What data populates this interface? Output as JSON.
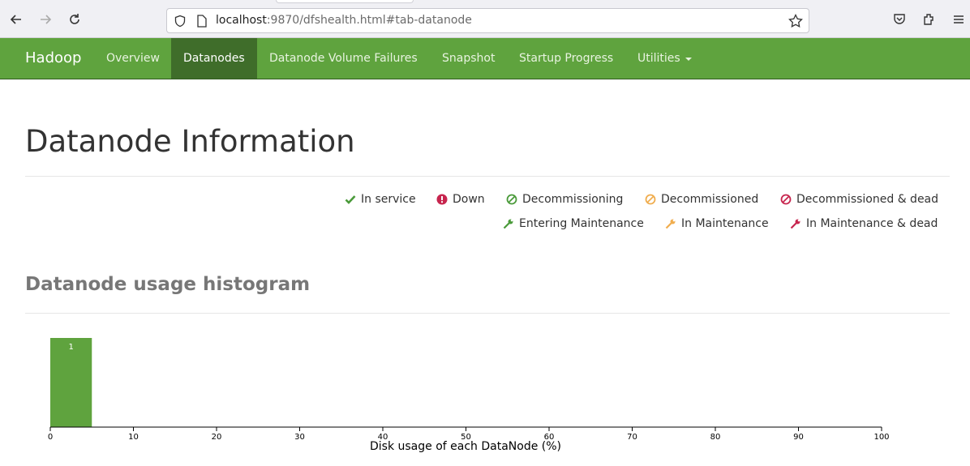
{
  "browser": {
    "url_host": "localhost",
    "url_rest": ":9870/dfshealth.html#tab-datanode"
  },
  "navbar": {
    "brand": "Hadoop",
    "items": [
      {
        "label": "Overview"
      },
      {
        "label": "Datanodes"
      },
      {
        "label": "Datanode Volume Failures"
      },
      {
        "label": "Snapshot"
      },
      {
        "label": "Startup Progress"
      },
      {
        "label": "Utilities"
      }
    ],
    "active_color": "#3f6d2a",
    "bar_color": "#5fa33e"
  },
  "page": {
    "title": "Datanode Information",
    "legend": [
      {
        "label": "In service",
        "icon": "check-icon",
        "color": "#4a9a3a"
      },
      {
        "label": "Down",
        "icon": "exclamation-circle-icon",
        "color": "#c7254e"
      },
      {
        "label": "Decommissioning",
        "icon": "ban-icon",
        "color": "#4a9a3a"
      },
      {
        "label": "Decommissioned",
        "icon": "ban-icon",
        "color": "#f0ad4e"
      },
      {
        "label": "Decommissioned & dead",
        "icon": "ban-icon",
        "color": "#c7254e"
      },
      {
        "label": "Entering Maintenance",
        "icon": "wrench-icon",
        "color": "#4a9a3a"
      },
      {
        "label": "In Maintenance",
        "icon": "wrench-icon",
        "color": "#f0ad4e"
      },
      {
        "label": "In Maintenance & dead",
        "icon": "wrench-icon",
        "color": "#c7254e"
      }
    ],
    "histogram_title": "Datanode usage histogram"
  },
  "chart_data": {
    "type": "bar",
    "title": "",
    "xlabel": "Disk usage of each DataNode (%)",
    "ylabel": "",
    "xlim": [
      0,
      100
    ],
    "x_ticks": [
      0,
      10,
      20,
      30,
      40,
      50,
      60,
      70,
      80,
      90,
      100
    ],
    "bins": [
      {
        "x0": 0,
        "x1": 5,
        "count": 1
      }
    ],
    "bar_color": "#5fa33e"
  }
}
